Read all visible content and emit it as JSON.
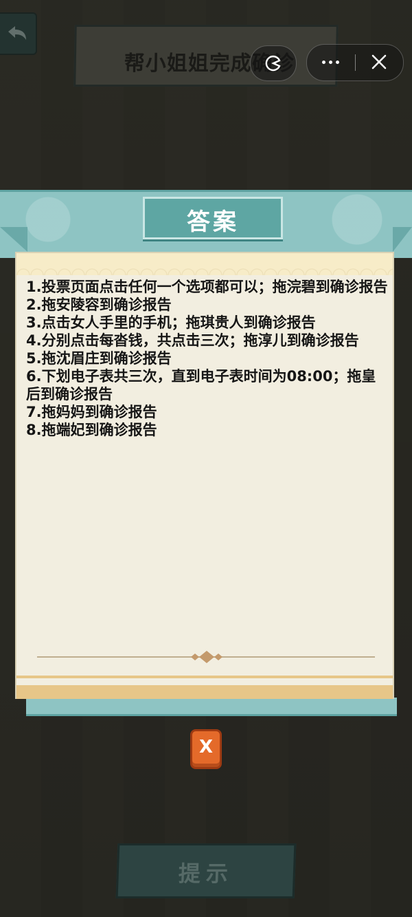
{
  "header": {
    "title": "帮小姐姐完成确诊"
  },
  "dialog": {
    "title": "答案",
    "answers": [
      "1.投票页面点击任何一个选项都可以；拖浣碧到确诊报告",
      "2.拖安陵容到确诊报告",
      "3.点击女人手里的手机；拖琪贵人到确诊报告",
      "4.分别点击每沓钱，共点击三次；拖淳儿到确诊报告",
      "5.拖沈眉庄到确诊报告",
      "6.下划电子表共三次，直到电子表时间为08:00；拖皇后到确诊报告",
      "7.拖妈妈到确诊报告",
      "8.拖端妃到确诊报告"
    ],
    "close_label": "X"
  },
  "footer": {
    "hint_label": "提示"
  },
  "icons": {
    "back": "back-arrow-icon",
    "capsule_left": "pacman-icon",
    "more": "more-dots-icon",
    "close": "close-icon"
  },
  "colors": {
    "teal": "#8ec4c3",
    "title_tab": "#5ea6a3",
    "paper": "#f2eee0",
    "close_button": "#e46a2a"
  }
}
